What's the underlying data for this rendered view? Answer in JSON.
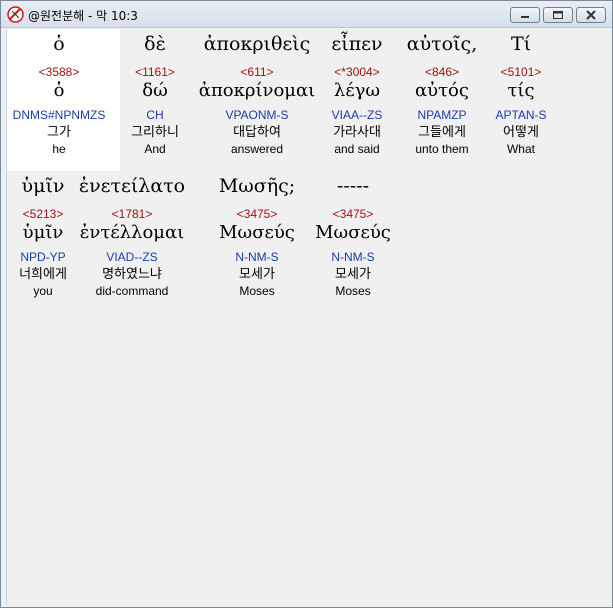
{
  "window": {
    "title": "@원전분해 - 막 10:3"
  },
  "words": [
    {
      "greek": "ὁ",
      "strong": "<3588>",
      "lemma": "ὁ",
      "parse": "DNMS#NPNMZS",
      "korean": "그가",
      "english": "he"
    },
    {
      "greek": "δὲ",
      "strong": "<1161>",
      "lemma": "δώ",
      "parse": "CH",
      "korean": "그리하니",
      "english": "And"
    },
    {
      "greek": "ἀποκριθεὶς",
      "strong": "<611>",
      "lemma": "ἀποκρίνομαι",
      "parse": "VPAONM-S",
      "korean": "대답하여",
      "english": "answered"
    },
    {
      "greek": "εἶπεν",
      "strong": "<*3004>",
      "lemma": "λέγω",
      "parse": "VIAA--ZS",
      "korean": "가라사대",
      "english": "and said"
    },
    {
      "greek": "αὐτοῖς,",
      "strong": "<846>",
      "lemma": "αὐτός",
      "parse": "NPAMZP",
      "korean": "그들에게",
      "english": "unto them"
    },
    {
      "greek": "Τί",
      "strong": "<5101>",
      "lemma": "τίς",
      "parse": "APTAN-S",
      "korean": "어떻게",
      "english": "What"
    },
    {
      "greek": "ὑμῖν",
      "strong": "<5213>",
      "lemma": "ὑμῖν",
      "parse": "NPD-YP",
      "korean": "너희에게",
      "english": "you"
    },
    {
      "greek": "ἐνετείλατο",
      "strong": "<1781>",
      "lemma": "ἐντέλλομαι",
      "parse": "VIAD--ZS",
      "korean": "명하였느냐",
      "english": "did-command"
    },
    {
      "greek": "Μωσῆς;",
      "strong": "<3475>",
      "lemma": "Μωσεύς",
      "parse": "N-NM-S",
      "korean": "모세가",
      "english": "Moses"
    },
    {
      "greek": "-----",
      "strong": "<3475>",
      "lemma": "Μωσεύς",
      "parse": "N-NM-S",
      "korean": "모세가",
      "english": "Moses"
    }
  ]
}
